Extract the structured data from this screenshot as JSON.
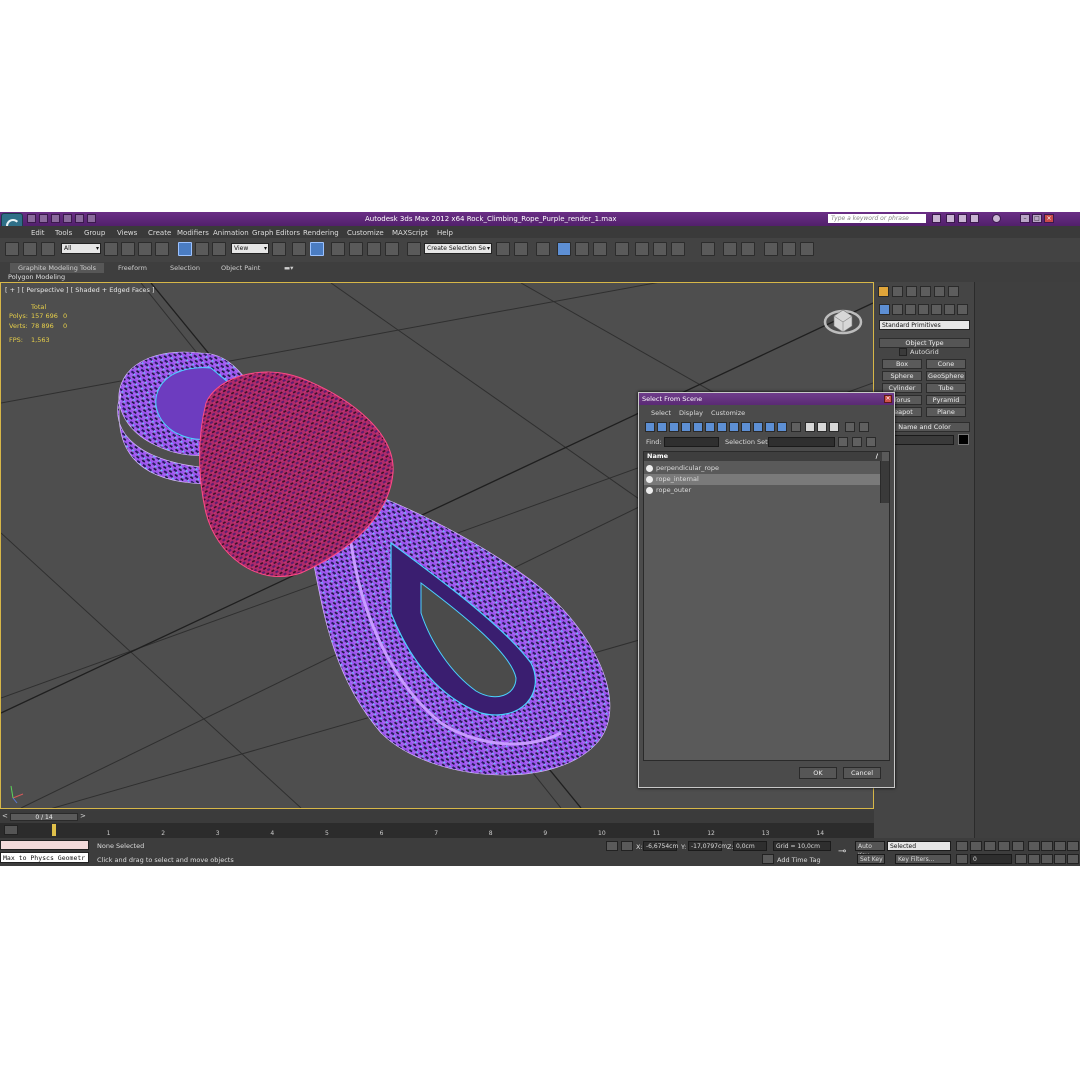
{
  "titlebar": {
    "title": "Autodesk 3ds Max  2012 x64      Rock_Climbing_Rope_Purple_render_1.max",
    "search_placeholder": "Type a keyword or phrase"
  },
  "menubar": [
    "Edit",
    "Tools",
    "Group",
    "Views",
    "Create",
    "Modifiers",
    "Animation",
    "Graph Editors",
    "Rendering",
    "Customize",
    "MAXScript",
    "Help"
  ],
  "toolbar": {
    "filter_value": "All",
    "refcoord_value": "View",
    "selection_set_placeholder": "Create Selection Se"
  },
  "ribbon": {
    "tabs": [
      "Graphite Modeling Tools",
      "Freeform",
      "Selection",
      "Object Paint"
    ],
    "panel_label": "Polygon Modeling"
  },
  "viewport": {
    "label": "[ + ] [ Perspective ] [ Shaded + Edged Faces ]",
    "stats": {
      "total_label": "Total",
      "polys_label": "Polys:",
      "polys_total": "157 696",
      "polys_sel": "0",
      "verts_label": "Verts:",
      "verts_total": "78 896",
      "verts_sel": "0",
      "fps_label": "FPS:",
      "fps_value": "1,563"
    }
  },
  "command_panel": {
    "category": "Standard Primitives",
    "object_type_title": "Object Type",
    "autogrid_label": "AutoGrid",
    "buttons": [
      "Box",
      "Cone",
      "Sphere",
      "GeoSphere",
      "Cylinder",
      "Tube",
      "Torus",
      "Pyramid",
      "Teapot",
      "Plane"
    ],
    "name_color_title": "Name and Color"
  },
  "dialog": {
    "title": "Select From Scene",
    "menus": [
      "Select",
      "Display",
      "Customize"
    ],
    "find_label": "Find:",
    "selection_set_label": "Selection Set:",
    "column_header": "Name",
    "sort_glyph": "/",
    "items": [
      "perpendicular_rope",
      "rope_internal",
      "rope_outer"
    ],
    "selected_index": 1,
    "ok_label": "OK",
    "cancel_label": "Cancel"
  },
  "timeline": {
    "slider_label": "0 / 14",
    "ticks": [
      "0",
      "1",
      "2",
      "3",
      "4",
      "5",
      "6",
      "7",
      "8",
      "9",
      "10",
      "11",
      "12",
      "13",
      "14"
    ]
  },
  "status": {
    "maxscript_text": "Max to Physcs Geometr",
    "selection_text": "None Selected",
    "prompt_text": "Click and drag to select and move objects",
    "x_label": "X:",
    "x_value": "-6,6754cm",
    "y_label": "Y:",
    "y_value": "-17,0797cm",
    "z_label": "Z:",
    "z_value": "0,0cm",
    "grid_text": "Grid = 10,0cm",
    "add_time_tag": "Add Time Tag",
    "auto_key": "Auto Key",
    "set_key": "Set Key",
    "key_mode_value": "Selected",
    "key_filters": "Key Filters...",
    "frame_value": "0"
  }
}
